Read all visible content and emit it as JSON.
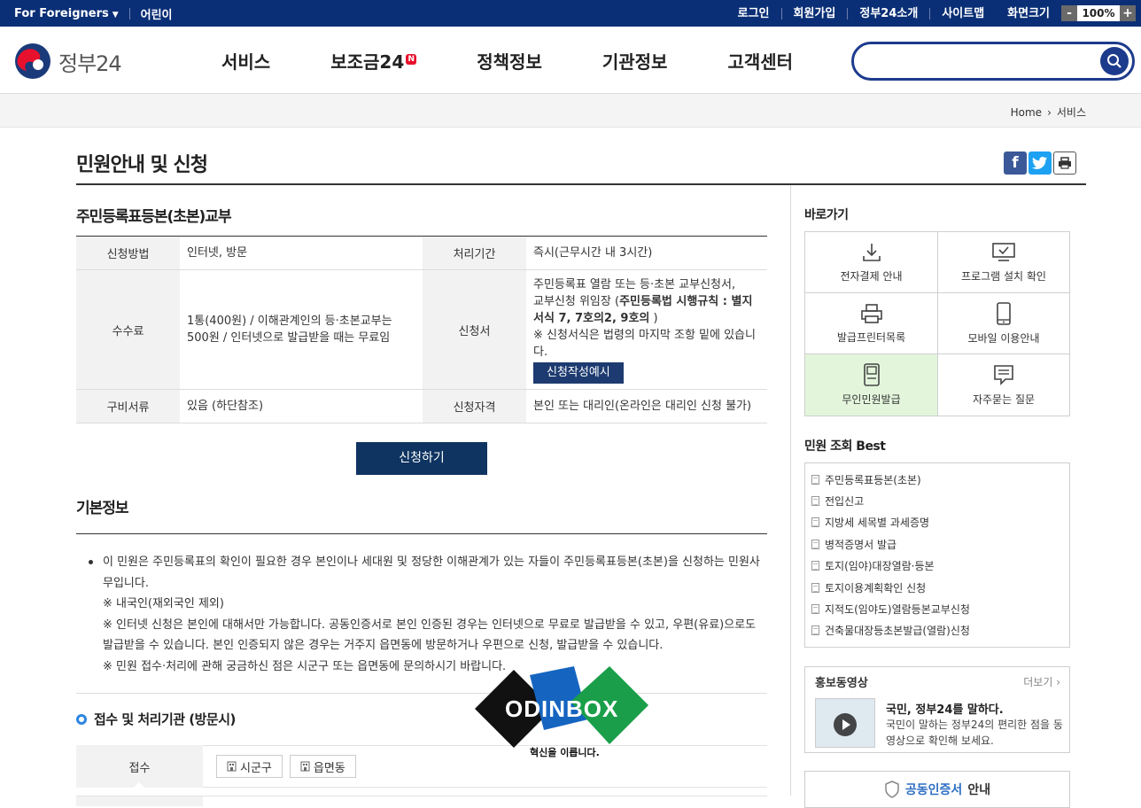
{
  "topbar": {
    "foreigners": "For Foreigners",
    "kids": "어린이",
    "links": [
      "로그인",
      "회원가입",
      "정부24소개",
      "사이트맵",
      "화면크기"
    ],
    "zoom_minus": "-",
    "zoom_value": "100%",
    "zoom_plus": "+"
  },
  "header": {
    "logo_text": "정부24",
    "nav": [
      "서비스",
      "보조금24",
      "정책정보",
      "기관정보",
      "고객센터"
    ],
    "new_badge": "N",
    "search_placeholder": ""
  },
  "breadcrumb": [
    "Home",
    "서비스"
  ],
  "page": {
    "title": "민원안내 및 신청"
  },
  "service": {
    "title": "주민등록표등본(초본)교부",
    "rows": {
      "method_label": "신청방법",
      "method_value": "인터넷, 방문",
      "period_label": "처리기간",
      "period_value": "즉시(근무시간 내 3시간)",
      "fee_label": "수수료",
      "fee_value": "1통(400원) / 이해관계인의 등·초본교부는 500원 / 인터넷으로 발급받을 때는 무료임",
      "form_label": "신청서",
      "form_line1": "주민등록표 열람 또는 등·초본 교부신청서,",
      "form_line2": "교부신청 위임장 (",
      "form_bold": "주민등록법 시행규칙 : 별지서식 7, 7호의2, 9호의",
      "form_line2_end": " )",
      "form_line3": "※ 신청서식은 법령의 마지막 조항 밑에 있습니다.",
      "form_button": "신청작성예시",
      "docs_label": "구비서류",
      "docs_value": "있음 (하단참조)",
      "qual_label": "신청자격",
      "qual_value": "본인 또는 대리인(온라인은 대리인 신청 불가)"
    },
    "apply_button": "신청하기"
  },
  "basic": {
    "title": "기본정보",
    "lines": [
      " 이 민원은 주민등록표의 확인이 필요한 경우 본인이나 세대원 및 정당한 이해관계가 있는 자들이 주민등록표등본(초본)을 신청하는 민원사무입니다.",
      "※ 내국인(재외국인 제외)",
      "※ 인터넷 신청은 본인에 대해서만 가능합니다. 공동인증서로 본인 인증된 경우는 인터넷으로 무료로 발급받을 수 있고, 우편(유료)으로도 발급받을 수 있습니다. 본인 인증되지 않은 경우는 거주지 읍면동에 방문하거나 우편으로 신청, 발급받을 수 있습니다.",
      "※ 민원 접수·처리에 관해 궁금하신 점은 시군구 또는 읍면동에 문의하시기 바랍니다."
    ]
  },
  "reception": {
    "title": "접수 및 처리기관 (방문시)",
    "label": "접수",
    "buttons": [
      "시군구",
      "읍면동"
    ]
  },
  "watermark": {
    "text": "ODINBOX",
    "sub": "혁신을 이릅니다."
  },
  "sidebar": {
    "shortcuts_title": "바로가기",
    "shortcuts": [
      {
        "label": "전자결제 안내",
        "icon": "download-icon"
      },
      {
        "label": "프로그램 설치 확인",
        "icon": "monitor-check-icon"
      },
      {
        "label": "발급프린터목록",
        "icon": "printer-icon"
      },
      {
        "label": "모바일 이용안내",
        "icon": "mobile-icon"
      },
      {
        "label": "무인민원발급",
        "icon": "kiosk-icon"
      },
      {
        "label": "자주묻는 질문",
        "icon": "faq-chat-icon"
      }
    ],
    "best_title": "민원 조회 Best",
    "best": [
      "주민등록표등본(초본)",
      "전입신고",
      "지방세 세목별 과세증명",
      "병적증명서 발급",
      "토지(임야)대장열람·등본",
      "토지이용계획확인 신청",
      "지적도(임야도)열람등본교부신청",
      "건축물대장등초본발급(열람)신청"
    ],
    "promo_title": "홍보동영상",
    "promo_more": "더보기",
    "promo_headline": "국민, 정부24를 말하다.",
    "promo_desc": "국민이 말하는 정부24의 편리한 점을 동영상으로 확인해 보세요.",
    "cert_highlight": "공동인증서",
    "cert_rest": " 안내"
  },
  "colors": {
    "topbar": "#0b2f76",
    "search_border": "#1d3b8c",
    "apply_button": "#0f3461",
    "kiosk_highlight": "#e3f6dc",
    "facebook": "#3b5998",
    "twitter": "#1da1f2"
  }
}
